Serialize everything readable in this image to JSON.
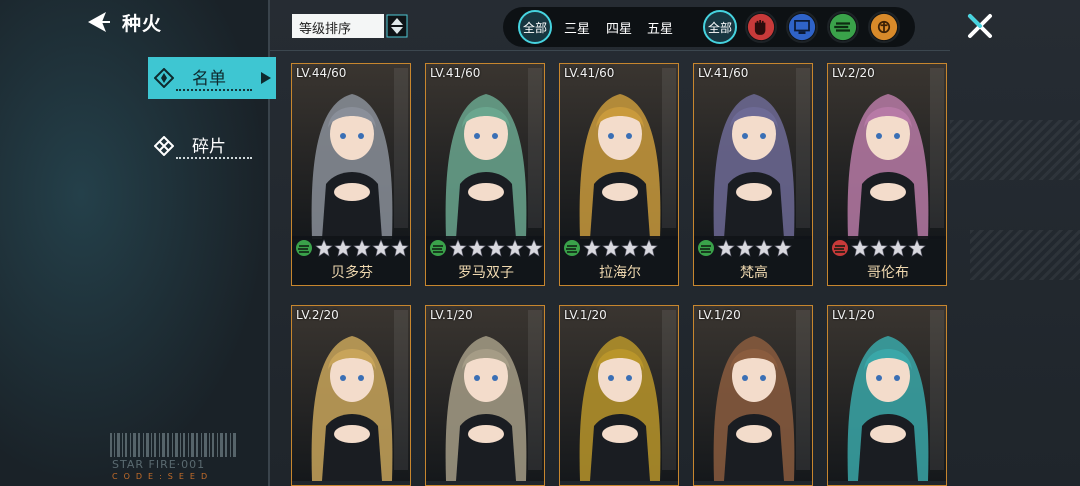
{
  "header": {
    "title": "种火",
    "sort_label": "等级排序"
  },
  "sidebar": {
    "tabs": [
      {
        "label": "名单",
        "active": true
      },
      {
        "label": "碎片",
        "active": false
      }
    ]
  },
  "filters": {
    "rarity": [
      "全部",
      "三星",
      "四星",
      "五星"
    ],
    "class_all": "全部",
    "class_icons": [
      "fist-icon",
      "tech-screen-icon",
      "speed-icon",
      "brain-icon"
    ]
  },
  "branding": {
    "text": "STAR FIRE·001",
    "code": "CODE:SEED"
  },
  "colors": {
    "accent": "#3ec6d2",
    "card_border": "#c7862e",
    "fist_class": "#c73a3a",
    "tech_class": "#2f63c8",
    "speed_class": "#3aa24a",
    "brain_class": "#d88a2a"
  },
  "cards": [
    {
      "level": "LV.44/60",
      "name": "贝多芬",
      "stars": 5,
      "class": "speed",
      "hue": "#8a8f99"
    },
    {
      "level": "LV.41/60",
      "name": "罗马双子",
      "stars": 5,
      "class": "speed",
      "hue": "#6aa68e"
    },
    {
      "level": "LV.41/60",
      "name": "拉海尔",
      "stars": 4,
      "class": "speed",
      "hue": "#c99a3c"
    },
    {
      "level": "LV.41/60",
      "name": "梵高",
      "stars": 4,
      "class": "speed",
      "hue": "#6d6a95"
    },
    {
      "level": "LV.2/20",
      "name": "哥伦布",
      "stars": 4,
      "class": "fist",
      "hue": "#b77aa6"
    },
    {
      "level": "LV.2/20",
      "name": "",
      "stars": 0,
      "class": "",
      "hue": "#c8a45a"
    },
    {
      "level": "LV.1/20",
      "name": "",
      "stars": 0,
      "class": "",
      "hue": "#a59c86"
    },
    {
      "level": "LV.1/20",
      "name": "",
      "stars": 0,
      "class": "",
      "hue": "#b9952a"
    },
    {
      "level": "LV.1/20",
      "name": "",
      "stars": 0,
      "class": "",
      "hue": "#8a5c3e"
    },
    {
      "level": "LV.1/20",
      "name": "",
      "stars": 0,
      "class": "",
      "hue": "#3aa7a8"
    }
  ]
}
